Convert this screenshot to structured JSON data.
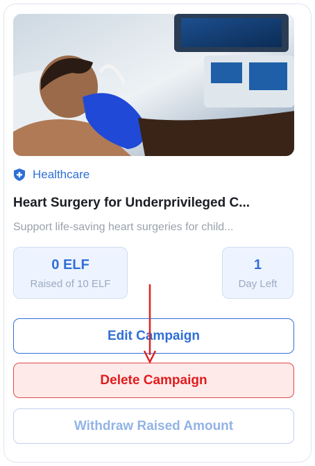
{
  "campaign": {
    "image_alt": "Child patient receiving heart ultrasound",
    "category": "Healthcare",
    "category_icon": "shield-icon",
    "title": "Heart Surgery for Underprivileged C...",
    "description": "Support life-saving heart surgeries for child..."
  },
  "stats": {
    "raised_value": "0 ELF",
    "raised_label": "Raised of 10 ELF",
    "days_value": "1",
    "days_label": "Day Left"
  },
  "actions": {
    "edit_label": "Edit Campaign",
    "delete_label": "Delete Campaign",
    "withdraw_label": "Withdraw Raised Amount"
  },
  "colors": {
    "accent": "#2f6fd6",
    "danger": "#e01c1c",
    "danger_bg": "#ffeaea",
    "annotation_arrow": "#e02020"
  }
}
